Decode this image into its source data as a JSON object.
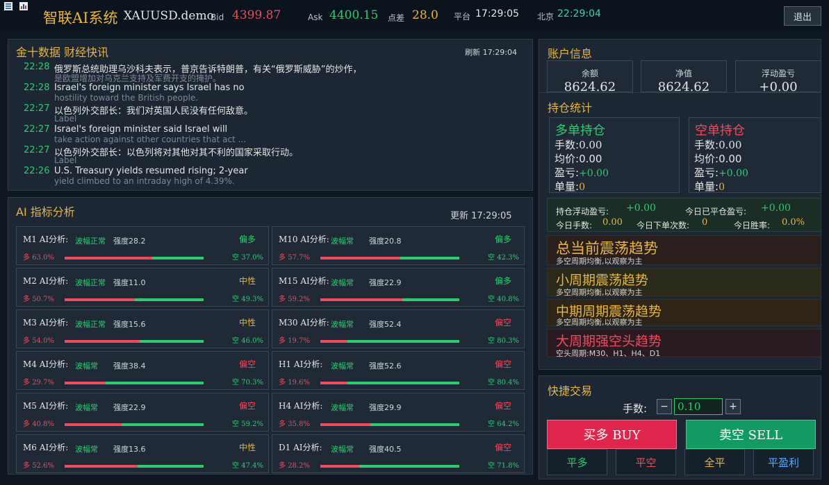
{
  "header": {
    "app_title": "智联AI系统",
    "account": "XAUUSD.demo",
    "bid_label": "Bid",
    "bid_value": "4399.87",
    "ask_label": "Ask",
    "ask_value": "4400.15",
    "spread_label": "点差",
    "spread_value": "28.0",
    "platform_label": "平台",
    "platform_time": "17:29:05",
    "beijing_label": "北京",
    "beijing_time": "22:29:04",
    "exit_label": "退出"
  },
  "news": {
    "title": "金十数据 财经快讯",
    "refresh": "刷新 17:29:04",
    "items": [
      {
        "time": "22:28",
        "title": "俄罗斯总统助理乌沙科夫表示，普京告诉特朗普，有关“俄罗斯威胁”的炒作，",
        "sub": "是欧盟增加对乌克兰支持及军费开支的掩护。"
      },
      {
        "time": "22:28",
        "title": "Israel's foreign minister says Israel has no",
        "sub": "hostility toward the British people."
      },
      {
        "time": "22:27",
        "title": "以色列外交部长：我们对英国人民没有任何敌意。",
        "sub": "Label"
      },
      {
        "time": "22:27",
        "title": "Israel's foreign minister said Israel will",
        "sub": "take action against other countries that act ..."
      },
      {
        "time": "22:27",
        "title": "以色列外交部长：以色列将对其他对其不利的国家采取行动。",
        "sub": "Label"
      },
      {
        "time": "22:26",
        "title": "U.S. Treasury yields resumed rising; 2-year",
        "sub": "yield climbed to an intraday high of 4.39%."
      }
    ]
  },
  "ai": {
    "title": "AI 指标分析",
    "updated": "更新 17:29:05",
    "long_prefix": "多",
    "short_prefix": "空",
    "cards": [
      {
        "name": "M1 AI分析:",
        "state": "波幅正常",
        "strength": "强度28.2",
        "verdict": "偏多",
        "long": "63.0%",
        "short": "37.0%",
        "long_pct": 63.0,
        "verdict_color": "#2ecc71"
      },
      {
        "name": "M10 AI分析:",
        "state": "波幅常",
        "strength": "强度20.8",
        "verdict": "偏多",
        "long": "57.7%",
        "short": "42.3%",
        "long_pct": 57.7,
        "verdict_color": "#2ecc71"
      },
      {
        "name": "M2 AI分析:",
        "state": "波幅正常",
        "strength": "强度11.0",
        "verdict": "中性",
        "long": "50.7%",
        "short": "49.3%",
        "long_pct": 50.7,
        "verdict_color": "#e8b540"
      },
      {
        "name": "M15 AI分析:",
        "state": "波幅常",
        "strength": "强度22.9",
        "verdict": "偏多",
        "long": "59.2%",
        "short": "40.8%",
        "long_pct": 59.2,
        "verdict_color": "#2ecc71"
      },
      {
        "name": "M3 AI分析:",
        "state": "波幅正常",
        "strength": "强度15.6",
        "verdict": "中性",
        "long": "54.0%",
        "short": "46.0%",
        "long_pct": 54.0,
        "verdict_color": "#e8b540"
      },
      {
        "name": "M30 AI分析:",
        "state": "波幅常",
        "strength": "强度52.4",
        "verdict": "偏空",
        "long": "19.7%",
        "short": "80.3%",
        "long_pct": 19.7,
        "verdict_color": "#ef4b5d"
      },
      {
        "name": "M4 AI分析:",
        "state": "波幅常",
        "strength": "强度38.4",
        "verdict": "偏空",
        "long": "29.7%",
        "short": "70.3%",
        "long_pct": 29.7,
        "verdict_color": "#ef4b5d"
      },
      {
        "name": "H1 AI分析:",
        "state": "波幅常",
        "strength": "强度52.6",
        "verdict": "偏空",
        "long": "19.6%",
        "short": "80.4%",
        "long_pct": 19.6,
        "verdict_color": "#ef4b5d"
      },
      {
        "name": "M5 AI分析:",
        "state": "波幅常",
        "strength": "强度22.9",
        "verdict": "偏空",
        "long": "40.8%",
        "short": "59.2%",
        "long_pct": 40.8,
        "verdict_color": "#ef4b5d"
      },
      {
        "name": "H4 AI分析:",
        "state": "波幅常",
        "strength": "强度29.9",
        "verdict": "偏空",
        "long": "35.8%",
        "short": "64.2%",
        "long_pct": 35.8,
        "verdict_color": "#ef4b5d"
      },
      {
        "name": "M6 AI分析:",
        "state": "波幅常",
        "strength": "强度13.6",
        "verdict": "中性",
        "long": "52.6%",
        "short": "47.4%",
        "long_pct": 52.6,
        "verdict_color": "#e8b540"
      },
      {
        "name": "D1 AI分析:",
        "state": "波幅常",
        "strength": "强度40.5",
        "verdict": "偏空",
        "long": "28.2%",
        "short": "71.8%",
        "long_pct": 28.2,
        "verdict_color": "#ef4b5d"
      }
    ]
  },
  "account_info": {
    "title": "账户信息",
    "balance_label": "余额",
    "balance": "8624.62",
    "equity_label": "净值",
    "equity": "8624.62",
    "float_label": "浮动盈亏",
    "float": "+0.00"
  },
  "positions": {
    "title": "持仓统计",
    "long": {
      "title": "多单持仓",
      "qty_label": "手数:",
      "qty": "0.00",
      "avg_label": "均价:",
      "avg": "0.00",
      "pnl_label": "盈亏:",
      "pnl": "+0.00",
      "count_label": "单量:",
      "count": "0"
    },
    "short": {
      "title": "空单持仓",
      "qty_label": "手数:",
      "qty": "0.00",
      "avg_label": "均价:",
      "avg": "0.00",
      "pnl_label": "盈亏:",
      "pnl": "+0.00",
      "count_label": "单量:",
      "count": "0"
    },
    "stats": {
      "float_label": "持仓浮动盈亏:",
      "float": "+0.00",
      "closed_label": "今日已平仓盈亏:",
      "closed": "+0.00",
      "lots_label": "今日手数:",
      "lots": "0.00",
      "orders_label": "今日下单次数:",
      "orders": "0",
      "winrate_label": "今日胜率:",
      "winrate": "0.0%"
    }
  },
  "trends": [
    {
      "title": "总当前震荡趋势",
      "desc": "多空周期均衡,以观察为主",
      "color": "#e8b540",
      "bg": "#2a1f1c"
    },
    {
      "title": "小周期震荡趋势",
      "desc": "多空周期均衡,以观察为主",
      "color": "#e8b540",
      "bg": "#2a2a1a"
    },
    {
      "title": "中期周期震荡趋势",
      "desc": "多空周期均衡,以观察为主",
      "color": "#e8b540",
      "bg": "#2e2518"
    },
    {
      "title": "大周期强空头趋势",
      "desc": "空头周期:M30、H1、H4、D1",
      "color": "#ef4b5d",
      "bg": "#2a1a22"
    }
  ],
  "quick_trade": {
    "title": "快捷交易",
    "lots_label": "手数:",
    "minus": "−",
    "plus": "+",
    "lots_value": "0.10",
    "buy_label": "买多 BUY",
    "sell_label": "卖空 SELL",
    "close_long": "平多",
    "close_short": "平空",
    "close_all": "全平",
    "close_profit": "平盈利"
  },
  "colors": {
    "accent": "#e8b540",
    "up": "#2ecc71",
    "down": "#ef4b5d",
    "buy": "#e0264c",
    "sell": "#129a62"
  }
}
